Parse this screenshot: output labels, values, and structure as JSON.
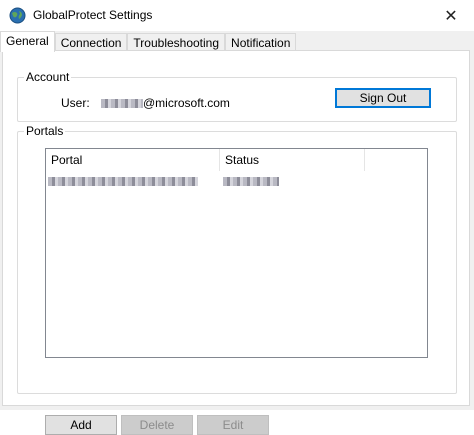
{
  "window": {
    "title": "GlobalProtect Settings",
    "close_glyph": "✕",
    "icon": "globe-icon"
  },
  "tabs": [
    {
      "label": "General",
      "active": true
    },
    {
      "label": "Connection",
      "active": false
    },
    {
      "label": "Troubleshooting",
      "active": false
    },
    {
      "label": "Notification",
      "active": false
    }
  ],
  "account": {
    "legend": "Account",
    "user_label": "User:",
    "user_value_visible": "@microsoft.com",
    "sign_out_label": "Sign Out"
  },
  "portals": {
    "legend": "Portals",
    "columns": [
      "Portal",
      "Status"
    ],
    "buttons": {
      "add": "Add",
      "delete": "Delete",
      "edit": "Edit"
    }
  },
  "colors": {
    "focus_border": "#0078d7",
    "button_bg": "#e1e1e1",
    "frame_bg": "#f0f0f0"
  }
}
